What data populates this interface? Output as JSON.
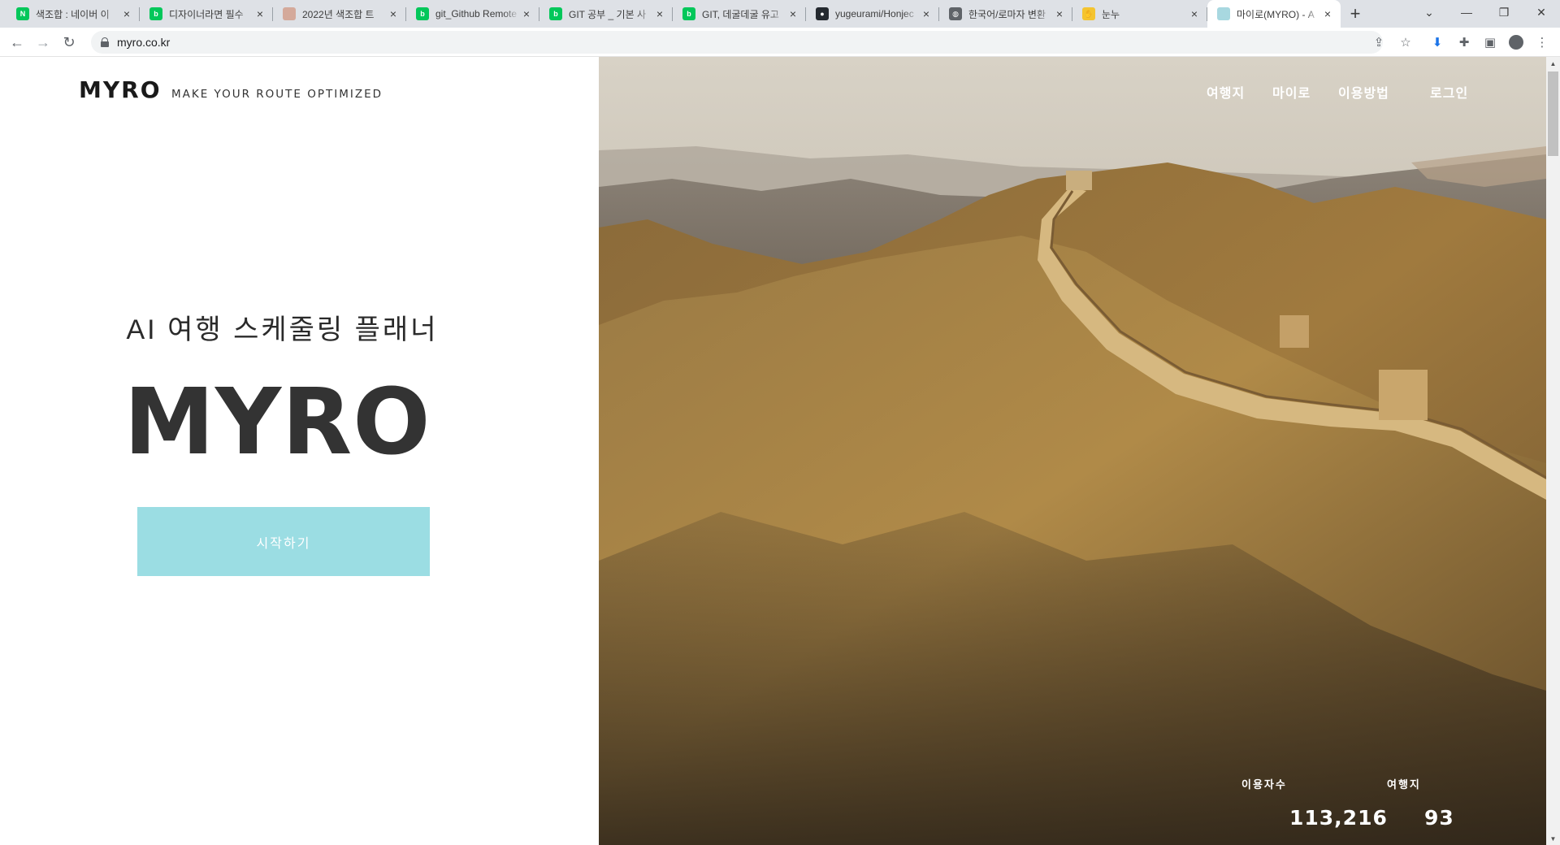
{
  "browser": {
    "tabs": [
      {
        "title": "색조합 : 네이버 이",
        "favicon_color": "#03c75a",
        "favicon_glyph": "N"
      },
      {
        "title": "디자이너라면 필수",
        "favicon_color": "#03c75a",
        "favicon_glyph": "b"
      },
      {
        "title": "2022년 색조합 트",
        "favicon_color": "#d4a99a",
        "favicon_glyph": ""
      },
      {
        "title": "git_Github Remote",
        "favicon_color": "#03c75a",
        "favicon_glyph": "b"
      },
      {
        "title": "GIT 공부 _ 기본 사",
        "favicon_color": "#03c75a",
        "favicon_glyph": "b"
      },
      {
        "title": "GIT, 데굴데굴 유고",
        "favicon_color": "#03c75a",
        "favicon_glyph": "b"
      },
      {
        "title": "yugeurami/Honjec",
        "favicon_color": "#24292f",
        "favicon_glyph": "●"
      },
      {
        "title": "한국어/로마자 변환",
        "favicon_color": "#5f6368",
        "favicon_glyph": "◍"
      },
      {
        "title": "눈누",
        "favicon_color": "#f4c430",
        "favicon_glyph": "✋"
      },
      {
        "title": "마이로(MYRO) - A",
        "favicon_color": "#a8d8e0",
        "favicon_glyph": "",
        "active": true
      }
    ],
    "url": "myro.co.kr",
    "icons": {
      "back": "arrow-left-icon",
      "forward": "arrow-right-icon",
      "reload": "reload-icon",
      "share": "share-icon",
      "star": "star-icon",
      "download": "download-icon",
      "extensions": "puzzle-icon",
      "sidepanel": "sidepanel-icon",
      "profile": "profile-icon",
      "menu": "kebab-menu-icon"
    }
  },
  "site": {
    "logo": "MYRO",
    "slogan": "MAKE YOUR ROUTE OPTIMIZED",
    "subtitle": "AI 여행 스케줄링 플래너",
    "hero_title": "MYRO",
    "cta_label": "시작하기",
    "cta_color": "#9bdde3",
    "nav": [
      "여행지",
      "마이로",
      "이용방법",
      "로그인"
    ],
    "stats": [
      {
        "label": "이용자수",
        "value": "113,216"
      },
      {
        "label": "여행지",
        "value": "93"
      }
    ]
  }
}
